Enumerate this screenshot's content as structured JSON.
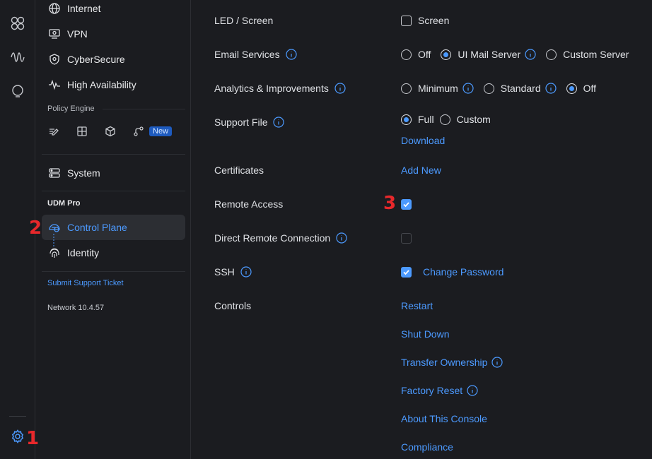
{
  "sidebar": {
    "items": {
      "internet": "Internet",
      "vpn": "VPN",
      "cybersecure": "CyberSecure",
      "high_availability": "High Availability",
      "system": "System",
      "control_plane": "Control Plane",
      "identity": "Identity"
    },
    "policy_engine_label": "Policy Engine",
    "new_badge": "New",
    "udm_section": "UDM Pro",
    "support_link": "Submit Support Ticket",
    "version": "Network 10.4.57"
  },
  "markers": {
    "one": "1",
    "two": "2",
    "three": "3"
  },
  "settings": {
    "led": {
      "label": "LED / Screen",
      "option": "Screen"
    },
    "email": {
      "label": "Email Services",
      "options": [
        "Off",
        "UI Mail Server",
        "Custom Server"
      ],
      "selected": "UI Mail Server"
    },
    "analytics": {
      "label": "Analytics & Improvements",
      "options": [
        "Minimum",
        "Standard",
        "Off"
      ],
      "selected": "Off"
    },
    "support_file": {
      "label": "Support File",
      "options": [
        "Full",
        "Custom"
      ],
      "selected": "Full",
      "download": "Download"
    },
    "certificates": {
      "label": "Certificates",
      "action": "Add New"
    },
    "remote_access": {
      "label": "Remote Access",
      "checked": true
    },
    "direct_remote": {
      "label": "Direct Remote Connection",
      "checked": false
    },
    "ssh": {
      "label": "SSH",
      "checked": true,
      "action": "Change Password"
    },
    "controls": {
      "label": "Controls",
      "actions": [
        "Restart",
        "Shut Down",
        "Transfer Ownership",
        "Factory Reset",
        "About This Console",
        "Compliance"
      ]
    }
  },
  "colors": {
    "accent": "#4c9aff",
    "background": "#1b1c20",
    "marker": "#e8282b"
  }
}
